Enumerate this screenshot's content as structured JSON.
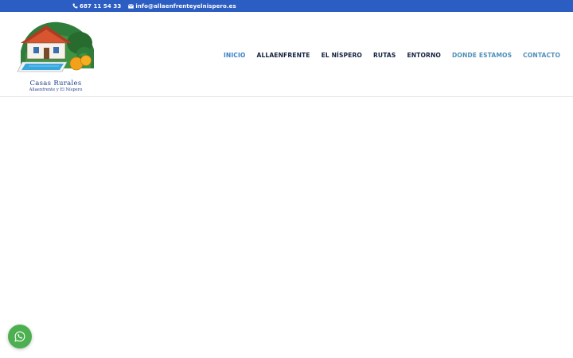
{
  "topbar": {
    "phone": "687 11 54 33",
    "email": "info@allaenfrenteyelnispero.es",
    "phone_icon": "phone-icon",
    "email_icon": "envelope-icon",
    "background": "#2b5dc2"
  },
  "logo": {
    "title": "Casas Rurales",
    "subtitle": "Allaenfrente y El Níspero"
  },
  "nav": {
    "items": [
      {
        "label": "INICIO"
      },
      {
        "label": "ALLAENFRENTE"
      },
      {
        "label": "EL NÍSPERO"
      },
      {
        "label": "RUTAS"
      },
      {
        "label": "ENTORNO"
      },
      {
        "label": "DONDE ESTAMOS"
      },
      {
        "label": "CONTACTO"
      }
    ],
    "active_color": "#3a7fc6",
    "text_color": "#14223f"
  },
  "whatsapp": {
    "icon": "whatsapp-icon",
    "color": "#4caf50"
  }
}
